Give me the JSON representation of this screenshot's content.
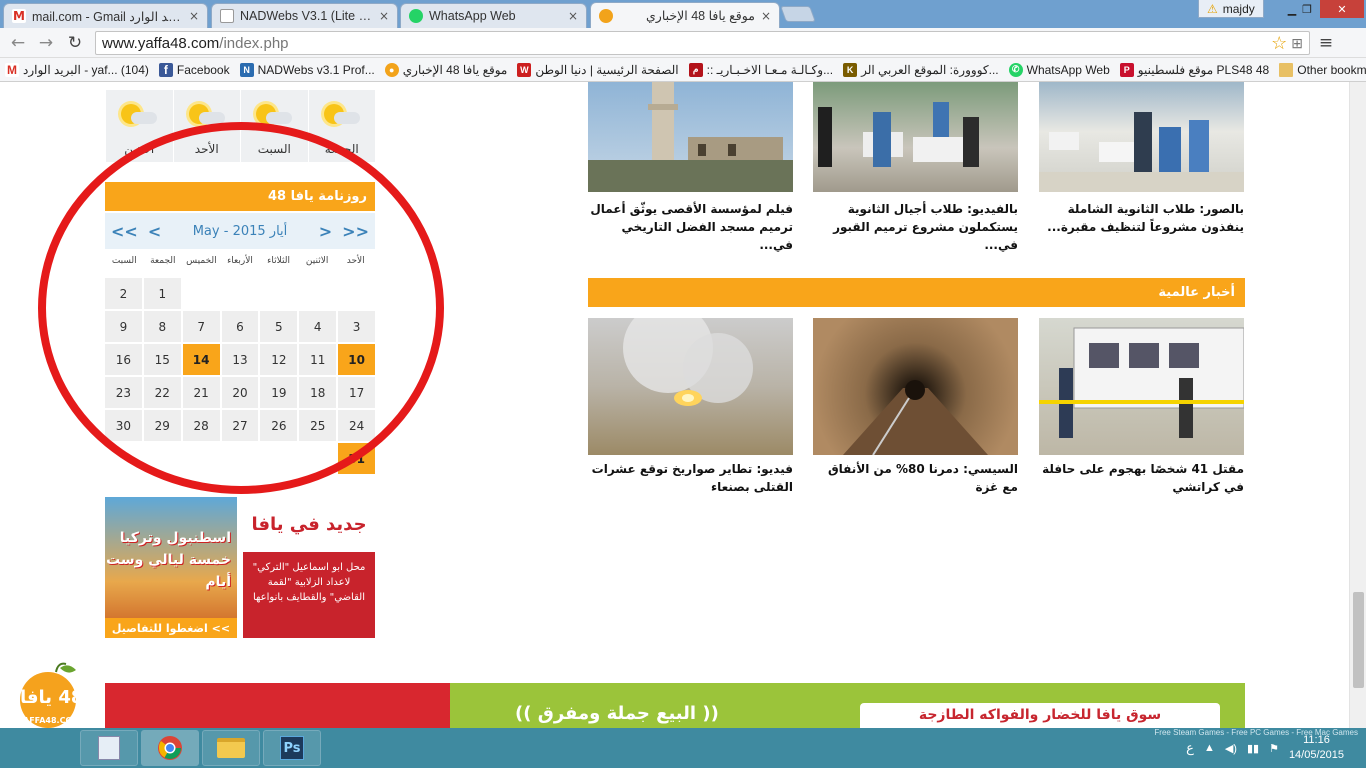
{
  "browser": {
    "tabs": [
      {
        "title": "mail.com - Gmail البريد الوارد",
        "icon": "gmail-icon"
      },
      {
        "title": "NADWebs V3.1 (Lite Versi",
        "icon": "page-icon"
      },
      {
        "title": "WhatsApp Web",
        "icon": "whatsapp-icon"
      },
      {
        "title": "موقع يافا 48 الإخباري",
        "icon": "yaffa-icon"
      }
    ],
    "close_glyph": "×",
    "user": "majdy",
    "warning_glyph": "⚠",
    "window": {
      "minimize": "▁",
      "restore": "❐",
      "close": "✕"
    },
    "nav": {
      "back": "←",
      "forward": "→",
      "reload": "↻"
    },
    "url": {
      "domain": "www.yaffa48.com",
      "path": "/index.php"
    },
    "omni_icons": {
      "star": "☆",
      "page": "⊞",
      "menu": "≡"
    },
    "bookmarks": [
      {
        "label": "البريد الوارد - yaf... (104)",
        "icon": "gmail-icon",
        "color": "#d93025",
        "glyph": "M"
      },
      {
        "label": "Facebook",
        "icon": "facebook-icon",
        "color": "#3b5998",
        "glyph": "f"
      },
      {
        "label": "NADWebs v3.1 Prof...",
        "icon": "nadwebs-icon",
        "color": "#2b6cb0",
        "glyph": "N"
      },
      {
        "label": "موقع يافا 48 الإخباري",
        "icon": "yaffa-icon",
        "color": "#f2a31b",
        "glyph": "●"
      },
      {
        "label": "الصفحة الرئيسية | دنيا الوطن",
        "icon": "watan-icon",
        "color": "#cc1f1f",
        "glyph": "W"
      },
      {
        "label": ":: وكـالـة مـعـا الاخـبـاريـ...",
        "icon": "maan-icon",
        "color": "#b3121a",
        "glyph": "م"
      },
      {
        "label": "كووورة: الموقع العربي الر...",
        "icon": "kooora-icon",
        "color": "#7a5c00",
        "glyph": "K"
      },
      {
        "label": "WhatsApp Web",
        "icon": "whatsapp-icon",
        "color": "#25d366",
        "glyph": "✆"
      },
      {
        "label": "موقع فلسطينيو PLS48 48",
        "icon": "pls48-icon",
        "color": "#c8102e",
        "glyph": "P"
      }
    ],
    "other_bookmarks": "Other bookmarks"
  },
  "weather": {
    "days": [
      "الجمعة",
      "السبت",
      "الأحد",
      "الاثنين"
    ]
  },
  "calendar": {
    "title": "روزنامة يافا 48",
    "month_label": "May - أيار 2015",
    "nav": {
      "prev_year": "<<",
      "prev": "<",
      "next": ">",
      "next_year": ">>"
    },
    "weekdays": [
      "الأحد",
      "الاثنين",
      "الثلاثاء",
      "الأربعاء",
      "الخميس",
      "الجمعة",
      "السبت"
    ],
    "weeks": [
      [
        "",
        "",
        "",
        "",
        "",
        "1",
        "2"
      ],
      [
        "3",
        "4",
        "5",
        "6",
        "7",
        "8",
        "9"
      ],
      [
        "10",
        "11",
        "12",
        "13",
        "14",
        "15",
        "16"
      ],
      [
        "17",
        "18",
        "19",
        "20",
        "21",
        "22",
        "23"
      ],
      [
        "24",
        "25",
        "26",
        "27",
        "28",
        "29",
        "30"
      ],
      [
        "31",
        "",
        "",
        "",
        "",
        "",
        ""
      ]
    ],
    "highlighted": [
      "10",
      "14",
      "31"
    ]
  },
  "ads": {
    "ad1": {
      "title": "اسطنبول وتركيا خمسة ليالي وست أيام",
      "cta": "اضغطوا للتفاصيل <<"
    },
    "ad2": {
      "title": "جديد في يافا",
      "body": "محل ابو اسماعيل \"التركي\" لاعداد الزلابية \"لقمة القاضي\" والقطايف بانواعها"
    }
  },
  "news_top": [
    {
      "caption": "بالصور: طلاب الثانوية الشاملة ينفذون مشروعاً لتنظيف مقبرة..."
    },
    {
      "caption": "بالفيديو: طلاب أجيال الثانوية يستكملون مشروع ترميم القبور في..."
    },
    {
      "caption": "فيلم لمؤسسة الأقصى يوثّق أعمال ترميم مسجد الفضل التاريخي في..."
    }
  ],
  "world_section": {
    "title": "أخبار عالمية"
  },
  "news_world": [
    {
      "caption": "مقتل 41 شخصًا بهجوم على حافلة في كراتشي"
    },
    {
      "caption": "السيسي: دمرنا 80% من الأنفاق مع غزة"
    },
    {
      "caption": "فيديو: تطاير صواريخ توقع عشرات القتلى بصنعاء"
    }
  ],
  "logo": {
    "text": "48 يافا",
    "sub": "YAFFA48.COM"
  },
  "banner": {
    "mid": "(( البيع جملة ومفرق ))",
    "right": "سوق يافا للخضار والفواكه الطازجة"
  },
  "taskbar": {
    "time": "11:16",
    "date": "14/05/2015",
    "lang": "ع",
    "watermark": "Free Steam Games - Free PC Games - Free Mac Games",
    "ps_label": "Ps"
  }
}
